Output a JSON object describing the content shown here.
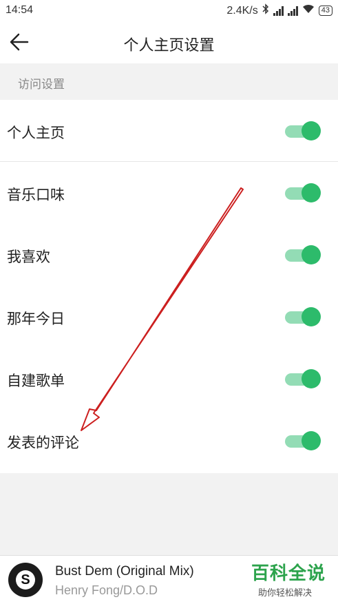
{
  "status_bar": {
    "time": "14:54",
    "speed": "2.4K/s",
    "battery": "43"
  },
  "header": {
    "title": "个人主页设置",
    "back_icon": "arrow-left-icon"
  },
  "section": {
    "title": "访问设置"
  },
  "settings": [
    {
      "label": "个人主页",
      "enabled": true
    },
    {
      "label": "音乐口味",
      "enabled": true
    },
    {
      "label": "我喜欢",
      "enabled": true
    },
    {
      "label": "那年今日",
      "enabled": true
    },
    {
      "label": "自建歌单",
      "enabled": true
    },
    {
      "label": "发表的评论",
      "enabled": true
    }
  ],
  "player": {
    "song": "Bust Dem (Original Mix)",
    "artist": "Henry Fong/D.O.D"
  },
  "watermark": {
    "title": "百科全说",
    "subtitle": "助你轻松解决"
  },
  "colors": {
    "toggle_on": "#2dbb6b",
    "toggle_track": "#93dcb5",
    "annotation_arrow": "#cc1f1f",
    "watermark": "#2ca34c"
  }
}
